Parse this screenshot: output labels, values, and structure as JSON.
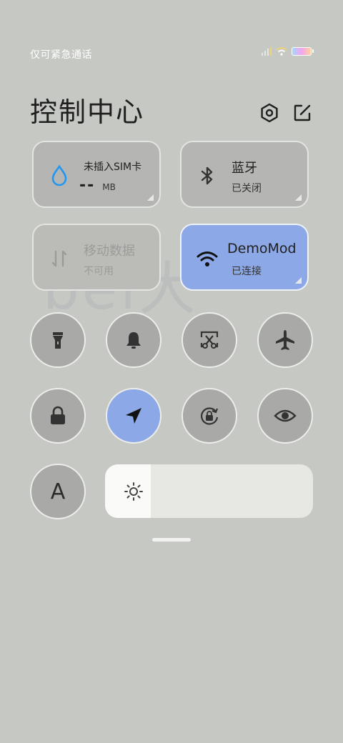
{
  "status_bar": {
    "carrier_text": "仅可紧急通话",
    "icons": [
      "signal-icon",
      "wifi-icon",
      "battery-icon"
    ],
    "battery_level": 0.9
  },
  "header": {
    "title": "控制中心",
    "icons": [
      "settings-icon",
      "edit-icon"
    ]
  },
  "tiles": {
    "sim": {
      "label": "未插入SIM卡",
      "value": "--",
      "unit": "MB",
      "icon": "water-drop-icon",
      "accent": "#2196f3"
    },
    "bluetooth": {
      "label": "蓝牙",
      "status": "已关闭",
      "icon": "bluetooth-icon"
    },
    "mobile_data": {
      "label": "移动数据",
      "status": "不可用",
      "icon": "data-transfer-icon"
    },
    "wifi": {
      "label": "DemoMod",
      "status": "已连接",
      "icon": "wifi-icon",
      "accent": "#8ca8e6"
    }
  },
  "toggles": [
    {
      "name": "flashlight",
      "icon": "flashlight-icon",
      "active": false
    },
    {
      "name": "notifications",
      "icon": "bell-icon",
      "active": false
    },
    {
      "name": "screenshot",
      "icon": "scissors-icon",
      "active": false
    },
    {
      "name": "airplane-mode",
      "icon": "airplane-icon",
      "active": false
    },
    {
      "name": "lock-screen",
      "icon": "lock-icon",
      "active": false
    },
    {
      "name": "location",
      "icon": "location-arrow-icon",
      "active": true
    },
    {
      "name": "rotation-lock",
      "icon": "rotation-lock-icon",
      "active": false
    },
    {
      "name": "reading-mode",
      "icon": "eye-icon",
      "active": false
    }
  ],
  "bottom": {
    "auto_text_label": "A",
    "brightness_level": 0.22,
    "brightness_icon": "sun-icon"
  },
  "watermark_text": "bei大"
}
